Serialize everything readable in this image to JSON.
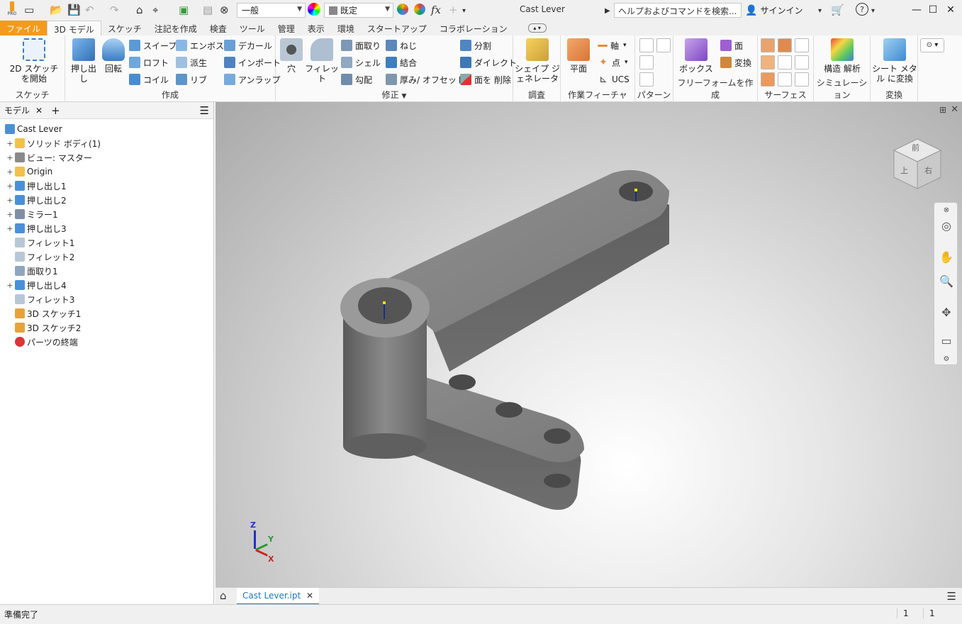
{
  "titlebar": {
    "style_value": "一般",
    "material_value": "既定",
    "title": "Cast Lever",
    "search_placeholder": "ヘルプおよびコマンドを検索...",
    "signin": "サインイン",
    "app_badge": "PRO"
  },
  "tabs": [
    "ファイル",
    "3D モデル",
    "スケッチ",
    "注記を作成",
    "検査",
    "ツール",
    "管理",
    "表示",
    "環境",
    "スタートアップ",
    "コラボレーション"
  ],
  "ribbon": {
    "sketch": {
      "title": "スケッチ",
      "start_2d": "2D スケッチを開始"
    },
    "create": {
      "title": "作成",
      "extrude": "押し出し",
      "revolve": "回転",
      "sweep": "スイープ",
      "loft": "ロフト",
      "coil": "コイル",
      "emboss": "エンボス",
      "derive": "派生",
      "rib": "リブ",
      "decal": "デカール",
      "import": "インポート",
      "unwrap": "アンラップ"
    },
    "modify": {
      "title": "修正",
      "hole": "穴",
      "fillet": "フィレット",
      "chamfer": "面取り",
      "shell": "シェル",
      "draft": "勾配",
      "thread": "ねじ",
      "combine": "結合",
      "thicken": "厚み/ オフセット",
      "split": "分割",
      "direct": "ダイレクト",
      "delete_face": "面を 削除"
    },
    "explore": {
      "title": "調査",
      "shape_gen": "シェイプ ジェネレータ"
    },
    "work": {
      "title": "作業フィーチャ",
      "plane": "平面",
      "axis": "軸",
      "point": "点",
      "ucs": "UCS"
    },
    "pattern": {
      "title": "パターン"
    },
    "freeform": {
      "title": "フリーフォームを作成",
      "box": "ボックス",
      "face": "面",
      "convert": "変換"
    },
    "surface": {
      "title": "サーフェス"
    },
    "simulation": {
      "title": "シミュレーション",
      "stress": "構造 解析"
    },
    "convert": {
      "title": "変換",
      "sheetmetal": "シート メタル に変換"
    }
  },
  "browser": {
    "title": "モデル",
    "items": [
      {
        "label": "Cast Lever",
        "icon": "part-icon",
        "expand": ""
      },
      {
        "label": "ソリッド ボディ(1)",
        "icon": "folder-icon",
        "expand": "+"
      },
      {
        "label": "ビュー: マスター",
        "icon": "view-icon",
        "expand": "+"
      },
      {
        "label": "Origin",
        "icon": "folder-icon",
        "expand": "+"
      },
      {
        "label": "押し出し1",
        "icon": "extrude-icon",
        "expand": "+"
      },
      {
        "label": "押し出し2",
        "icon": "extrude-icon",
        "expand": "+"
      },
      {
        "label": "ミラー1",
        "icon": "mirror-icon",
        "expand": "+"
      },
      {
        "label": "押し出し3",
        "icon": "extrude-icon",
        "expand": "+"
      },
      {
        "label": "フィレット1",
        "icon": "fillet-icon",
        "expand": ""
      },
      {
        "label": "フィレット2",
        "icon": "fillet-icon",
        "expand": ""
      },
      {
        "label": "面取り1",
        "icon": "chamfer-icon",
        "expand": ""
      },
      {
        "label": "押し出し4",
        "icon": "extrude-icon",
        "expand": "+"
      },
      {
        "label": "フィレット3",
        "icon": "fillet-icon",
        "expand": ""
      },
      {
        "label": "3D スケッチ1",
        "icon": "sketch3d-icon",
        "expand": ""
      },
      {
        "label": "3D スケッチ2",
        "icon": "sketch3d-icon",
        "expand": ""
      },
      {
        "label": "パーツの終端",
        "icon": "end-of-part-icon",
        "expand": ""
      }
    ]
  },
  "viewcube": {
    "top_face": "前",
    "front_face": "上",
    "right_face": "右"
  },
  "triad": {
    "x": "X",
    "y": "Y",
    "z": "Z"
  },
  "document_tab": "Cast Lever.ipt",
  "status": {
    "text": "準備完了",
    "count1": "1",
    "count2": "1"
  },
  "colors": {
    "file_tab": "#f49a1c",
    "accent": "#1a78c2",
    "extrude": "#4a90d9",
    "part": "#7d7d7d"
  }
}
